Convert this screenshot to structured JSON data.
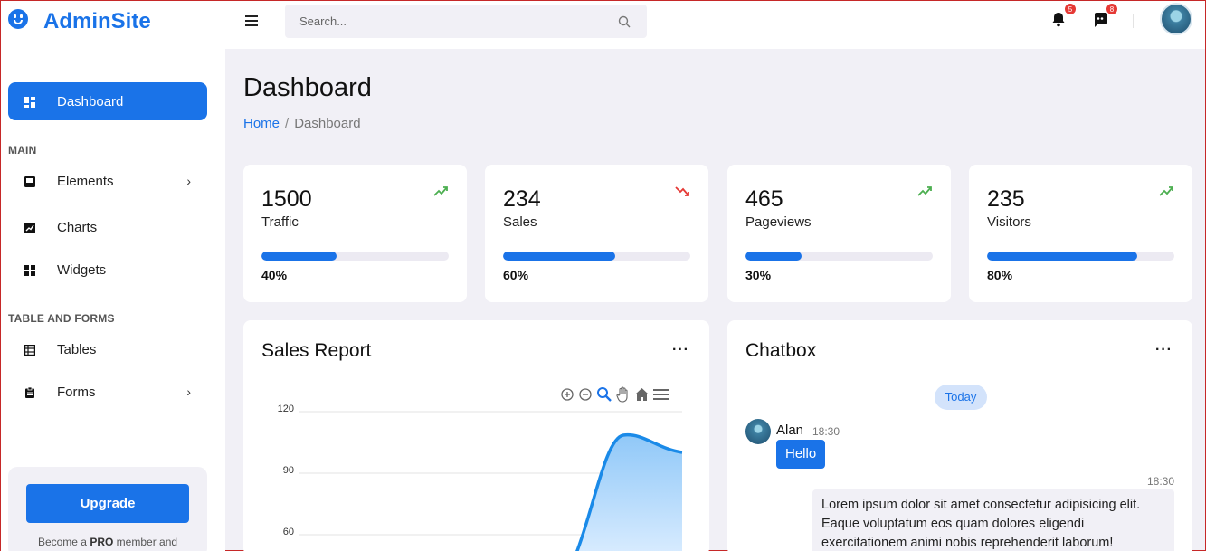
{
  "brand": {
    "name": "AdminSite"
  },
  "search": {
    "placeholder": "Search..."
  },
  "header": {
    "notifications_count": "5",
    "messages_count": "8"
  },
  "sidebar": {
    "dashboard": "Dashboard",
    "section_main": "MAIN",
    "elements": "Elements",
    "charts": "Charts",
    "widgets": "Widgets",
    "section_table_forms": "TABLE AND FORMS",
    "tables": "Tables",
    "forms": "Forms",
    "upgrade_button": "Upgrade",
    "upgrade_text_pre": "Become a ",
    "upgrade_text_bold": "PRO",
    "upgrade_text_post": " member and"
  },
  "page": {
    "title": "Dashboard",
    "breadcrumb_home": "Home",
    "breadcrumb_separator": "/",
    "breadcrumb_current": "Dashboard"
  },
  "stats": [
    {
      "value": "1500",
      "label": "Traffic",
      "percent": "40%",
      "progress": 40,
      "trend": "up",
      "trend_color": "#4caf50"
    },
    {
      "value": "234",
      "label": "Sales",
      "percent": "60%",
      "progress": 60,
      "trend": "down",
      "trend_color": "#e53935"
    },
    {
      "value": "465",
      "label": "Pageviews",
      "percent": "30%",
      "progress": 30,
      "trend": "up",
      "trend_color": "#4caf50"
    },
    {
      "value": "235",
      "label": "Visitors",
      "percent": "80%",
      "progress": 80,
      "trend": "up",
      "trend_color": "#4caf50"
    }
  ],
  "sales_report": {
    "title": "Sales Report",
    "more": "···",
    "y_ticks": [
      "120",
      "90",
      "60"
    ]
  },
  "chatbox": {
    "title": "Chatbox",
    "more": "···",
    "day": "Today",
    "incoming_name": "Alan",
    "incoming_time": "18:30",
    "incoming_text": "Hello",
    "outgoing_time": "18:30",
    "outgoing_text": "Lorem ipsum dolor sit amet consectetur adipisicing elit. Eaque voluptatum eos quam dolores eligendi exercitationem animi nobis reprehenderit laborum!"
  },
  "colors": {
    "accent": "#1a73e8",
    "background": "#f1f0f6",
    "up": "#4caf50",
    "down": "#e53935"
  }
}
